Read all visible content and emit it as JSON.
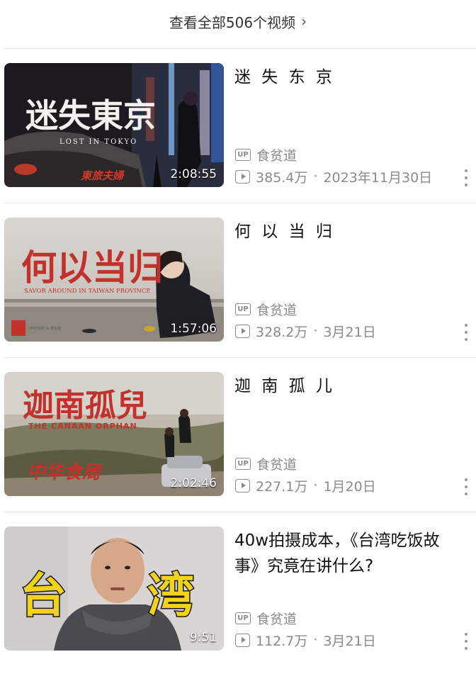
{
  "header": {
    "label": "查看全部506个视频",
    "chevron": "›"
  },
  "videos": [
    {
      "title": "迷 失 东 京",
      "thumb_text": "迷失東京",
      "thumb_subtitle": "LOST IN TOKYO",
      "thumb_sign": "東旅夫婦",
      "duration": "2:08:55",
      "author": "食贫道",
      "views": "385.4万",
      "date": "2023年11月30日"
    },
    {
      "title": "何 以 当 归",
      "thumb_text": "何以当归",
      "thumb_subtitle": "SAVOR AROUND IN TAIWAN PROVINCE",
      "thumb_sign": "UPRISING & 食贫道",
      "duration": "1:57:06",
      "author": "食贫道",
      "views": "328.2万",
      "date": "3月21日"
    },
    {
      "title": "迦 南 孤 儿",
      "thumb_text": "迦南孤兒",
      "thumb_subtitle": "THE CANAAN ORPHAN",
      "thumb_sign": "中华食局",
      "duration": "2:02:46",
      "author": "食贫道",
      "views": "227.1万",
      "date": "1月20日"
    },
    {
      "title": "40w拍摄成本，《台湾吃饭故事》究竟在讲什么?",
      "thumb_text": "台湾",
      "duration": "9:51",
      "author": "食贫道",
      "views": "112.7万",
      "date": "3月21日"
    }
  ],
  "up_badge": "UP",
  "separator": "·",
  "icons": [
    "chevron-right-icon",
    "up-badge-icon",
    "play-count-icon",
    "more-icon"
  ],
  "colors": {
    "meta_gray": "#8a8a8a",
    "thumb_red": "#c0322b",
    "thumb_yellow": "#f2d21b"
  }
}
